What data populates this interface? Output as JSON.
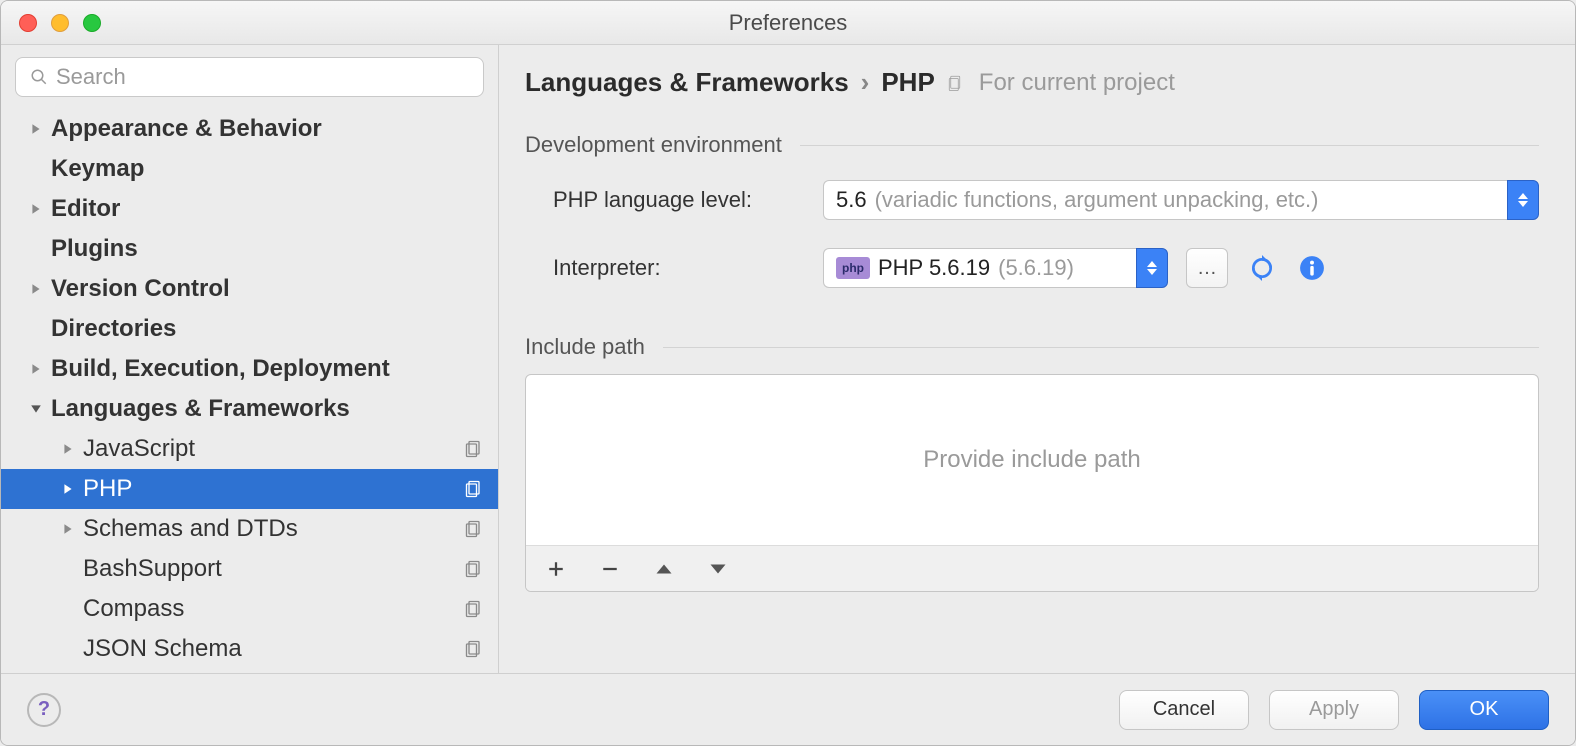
{
  "window": {
    "title": "Preferences"
  },
  "search": {
    "placeholder": "Search"
  },
  "sidebar": {
    "items": [
      {
        "label": "Appearance & Behavior",
        "bold": true,
        "arrow": "right"
      },
      {
        "label": "Keymap",
        "bold": true
      },
      {
        "label": "Editor",
        "bold": true,
        "arrow": "right"
      },
      {
        "label": "Plugins",
        "bold": true
      },
      {
        "label": "Version Control",
        "bold": true,
        "arrow": "right"
      },
      {
        "label": "Directories",
        "bold": true
      },
      {
        "label": "Build, Execution, Deployment",
        "bold": true,
        "arrow": "right"
      },
      {
        "label": "Languages & Frameworks",
        "bold": true,
        "arrow": "down",
        "expanded": true
      },
      {
        "label": "JavaScript",
        "child": true,
        "arrow": "right",
        "proj": true
      },
      {
        "label": "PHP",
        "child": true,
        "arrow": "right",
        "proj": true,
        "selected": true
      },
      {
        "label": "Schemas and DTDs",
        "child": true,
        "arrow": "right",
        "proj": true
      },
      {
        "label": "BashSupport",
        "child": true,
        "proj": true
      },
      {
        "label": "Compass",
        "child": true,
        "proj": true
      },
      {
        "label": "JSON Schema",
        "child": true,
        "proj": true
      }
    ]
  },
  "breadcrumb": {
    "parent": "Languages & Frameworks",
    "current": "PHP",
    "hint": "For current project"
  },
  "dev_env": {
    "section": "Development environment",
    "lang_level_label": "PHP language level:",
    "lang_level_value": "5.6",
    "lang_level_desc": "(variadic functions, argument unpacking, etc.)",
    "interpreter_label": "Interpreter:",
    "interpreter_name": "PHP 5.6.19",
    "interpreter_version": "(5.6.19)"
  },
  "include": {
    "section": "Include path",
    "placeholder": "Provide include path"
  },
  "footer": {
    "cancel": "Cancel",
    "apply": "Apply",
    "ok": "OK"
  }
}
